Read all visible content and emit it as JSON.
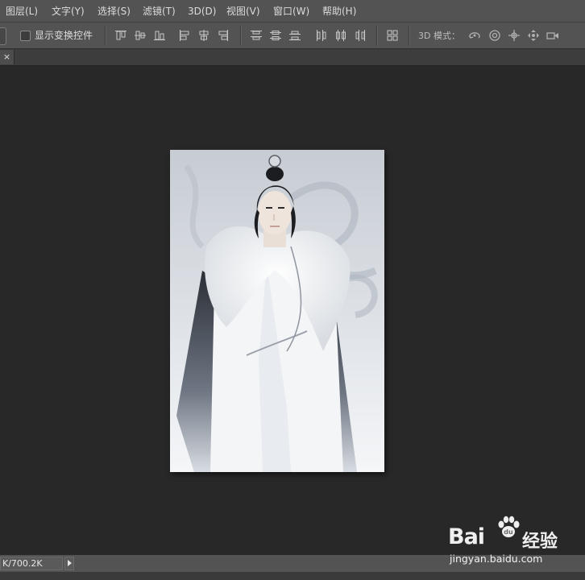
{
  "menubar": {
    "items": [
      {
        "label": "图层(L)"
      },
      {
        "label": "文字(Y)"
      },
      {
        "label": "选择(S)"
      },
      {
        "label": "滤镜(T)"
      },
      {
        "label": "3D(D)"
      },
      {
        "label": "视图(V)"
      },
      {
        "label": "窗口(W)"
      },
      {
        "label": "帮助(H)"
      }
    ]
  },
  "options": {
    "show_transform_controls_label": "显示变换控件",
    "show_transform_controls_checked": false,
    "mode_3d_label": "3D 模式："
  },
  "tabbar": {
    "close_glyph": "×"
  },
  "status": {
    "doc_size": "K/700.2K"
  },
  "watermark": {
    "brand_left": "Bai",
    "brand_right": "经验",
    "url": "jingyan.baidu.com"
  },
  "colors": {
    "chrome": "#535353",
    "workspace": "#282828",
    "paper": "#eef1f3"
  },
  "icons": {
    "align": [
      "align-top-edges-icon",
      "align-vertical-centers-icon",
      "align-bottom-edges-icon",
      "align-left-edges-icon",
      "align-horizontal-centers-icon",
      "align-right-edges-icon",
      "distribute-top-edges-icon",
      "distribute-vertical-centers-icon",
      "distribute-bottom-edges-icon",
      "distribute-left-edges-icon",
      "distribute-horizontal-centers-icon",
      "distribute-right-edges-icon",
      "auto-align-layers-icon"
    ],
    "mode3d": [
      "rotate-3d-icon",
      "roll-3d-icon",
      "drag-3d-icon",
      "slide-3d-icon",
      "camera-3d-icon"
    ]
  }
}
